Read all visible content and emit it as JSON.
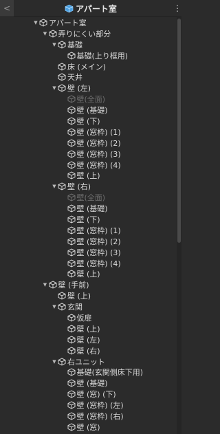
{
  "header": {
    "back_icon": "chevron-left-icon",
    "back_glyph": "<",
    "title": "アパート室",
    "menu_glyph": "⋮"
  },
  "tree": [
    {
      "label": "アパート室",
      "level": 0,
      "expanded": true
    },
    {
      "label": "弄りにくい部分",
      "level": 1,
      "expanded": true
    },
    {
      "label": "基礎",
      "level": 2,
      "expanded": true
    },
    {
      "label": "基礎(上り框用)",
      "level": 3
    },
    {
      "label": "床 (メイン)",
      "level": 2
    },
    {
      "label": "天井",
      "level": 2
    },
    {
      "label": "壁 (左)",
      "level": 2,
      "expanded": true
    },
    {
      "label": "壁(全面)",
      "level": 3,
      "disabled": true
    },
    {
      "label": "壁 (基礎)",
      "level": 3
    },
    {
      "label": "壁 (下)",
      "level": 3
    },
    {
      "label": "壁 (窓枠) (1)",
      "level": 3
    },
    {
      "label": "壁 (窓枠) (2)",
      "level": 3
    },
    {
      "label": "壁 (窓枠) (3)",
      "level": 3
    },
    {
      "label": "壁 (窓枠) (4)",
      "level": 3
    },
    {
      "label": "壁 (上)",
      "level": 3
    },
    {
      "label": "壁 (右)",
      "level": 2,
      "expanded": true
    },
    {
      "label": "壁(全面)",
      "level": 3,
      "disabled": true
    },
    {
      "label": "壁 (基礎)",
      "level": 3
    },
    {
      "label": "壁 (下)",
      "level": 3
    },
    {
      "label": "壁 (窓枠) (1)",
      "level": 3
    },
    {
      "label": "壁 (窓枠) (2)",
      "level": 3
    },
    {
      "label": "壁 (窓枠) (3)",
      "level": 3
    },
    {
      "label": "壁 (窓枠) (4)",
      "level": 3
    },
    {
      "label": "壁 (上)",
      "level": 3
    },
    {
      "label": "壁 (手前)",
      "level": 1,
      "expanded": true
    },
    {
      "label": "壁 (上)",
      "level": 2
    },
    {
      "label": "玄関",
      "level": 2,
      "expanded": true
    },
    {
      "label": "仮扉",
      "level": 3
    },
    {
      "label": "壁 (上)",
      "level": 3
    },
    {
      "label": "壁 (左)",
      "level": 3
    },
    {
      "label": "壁 (右)",
      "level": 3
    },
    {
      "label": "右ユニット",
      "level": 2,
      "expanded": true
    },
    {
      "label": "基礎(玄関側床下用)",
      "level": 3
    },
    {
      "label": "壁 (基礎)",
      "level": 3
    },
    {
      "label": "壁 (窓) (下)",
      "level": 3
    },
    {
      "label": "壁 (窓枠) (左)",
      "level": 3
    },
    {
      "label": "壁 (窓枠) (右)",
      "level": 3
    },
    {
      "label": "壁 (窓)",
      "level": 3
    }
  ]
}
